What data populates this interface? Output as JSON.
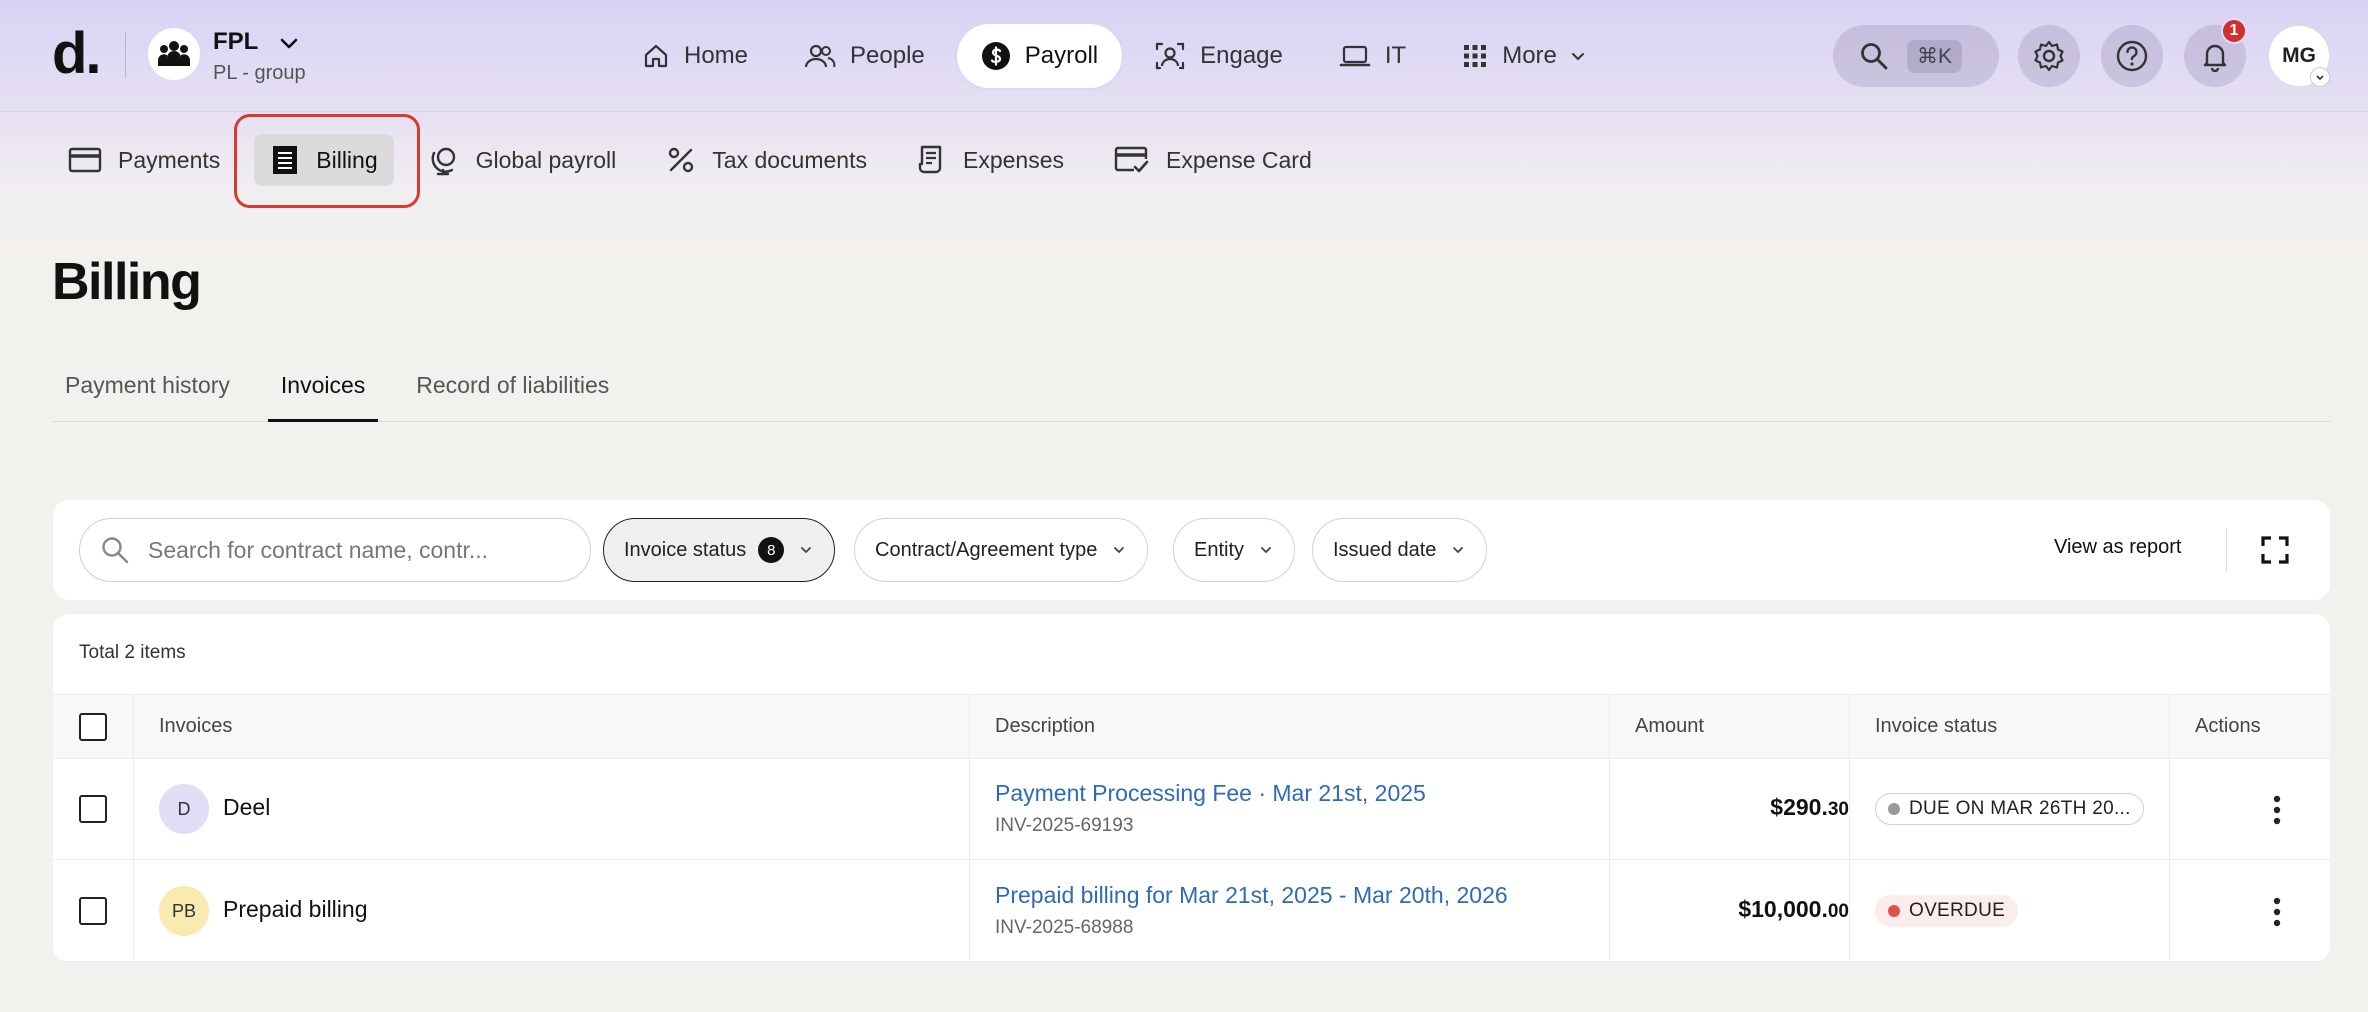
{
  "colors": {
    "accent_red": "#d83a2c",
    "link_blue": "#2f6bb5",
    "notification_badge": "#d0312d",
    "overdue_dot": "#d9534f",
    "due_dot": "#999999"
  },
  "brand": {
    "logo": "d."
  },
  "org": {
    "name": "FPL",
    "subtitle": "PL - group",
    "icon": "group-icon"
  },
  "main_nav": {
    "items": [
      {
        "label": "Home",
        "icon": "home-icon"
      },
      {
        "label": "People",
        "icon": "people-icon"
      },
      {
        "label": "Payroll",
        "icon": "dollar-icon",
        "active": true
      },
      {
        "label": "Engage",
        "icon": "engage-icon"
      },
      {
        "label": "IT",
        "icon": "laptop-icon"
      },
      {
        "label": "More",
        "icon": "grid-icon"
      }
    ]
  },
  "header_actions": {
    "search_shortcut": "⌘K",
    "notification_count": "1",
    "user_initials": "MG"
  },
  "sub_nav": {
    "items": [
      {
        "label": "Payments",
        "icon": "card-icon"
      },
      {
        "label": "Billing",
        "icon": "receipt-icon",
        "active": true
      },
      {
        "label": "Global payroll",
        "icon": "globe-icon"
      },
      {
        "label": "Tax documents",
        "icon": "percent-icon"
      },
      {
        "label": "Expenses",
        "icon": "expense-icon"
      },
      {
        "label": "Expense Card",
        "icon": "card-check-icon"
      }
    ]
  },
  "page": {
    "title": "Billing"
  },
  "tabs": [
    {
      "label": "Payment history"
    },
    {
      "label": "Invoices",
      "active": true
    },
    {
      "label": "Record of liabilities"
    }
  ],
  "filters": {
    "search_placeholder": "Search for contract name, contr...",
    "invoice_status": {
      "label": "Invoice status",
      "count": "8"
    },
    "contract_type": "Contract/Agreement type",
    "entity": "Entity",
    "issued_date": "Issued date",
    "view_report": "View as report"
  },
  "table": {
    "total": "Total 2 items",
    "columns": [
      "Invoices",
      "Description",
      "Amount",
      "Invoice status",
      "Actions"
    ],
    "rows": [
      {
        "avatar": "D",
        "avatar_color": "#e3dcf6",
        "name": "Deel",
        "description": "Payment Processing Fee · Mar 21st, 2025",
        "invoice_id": "INV-2025-69193",
        "amount_main": "$290.",
        "amount_cents": "30",
        "status": "DUE ON MAR 26TH 20...",
        "status_bg": "#ffffff",
        "status_border": "#cfcfcf",
        "status_dot": "#999999"
      },
      {
        "avatar": "PB",
        "avatar_color": "#f8ebb0",
        "name": "Prepaid billing",
        "description": "Prepaid billing for Mar 21st, 2025 - Mar 20th, 2026",
        "invoice_id": "INV-2025-68988",
        "amount_main": "$10,000.",
        "amount_cents": "00",
        "status": "OVERDUE",
        "status_bg": "#fcecec",
        "status_border": "#fcecec",
        "status_dot": "#d9534f"
      }
    ]
  }
}
